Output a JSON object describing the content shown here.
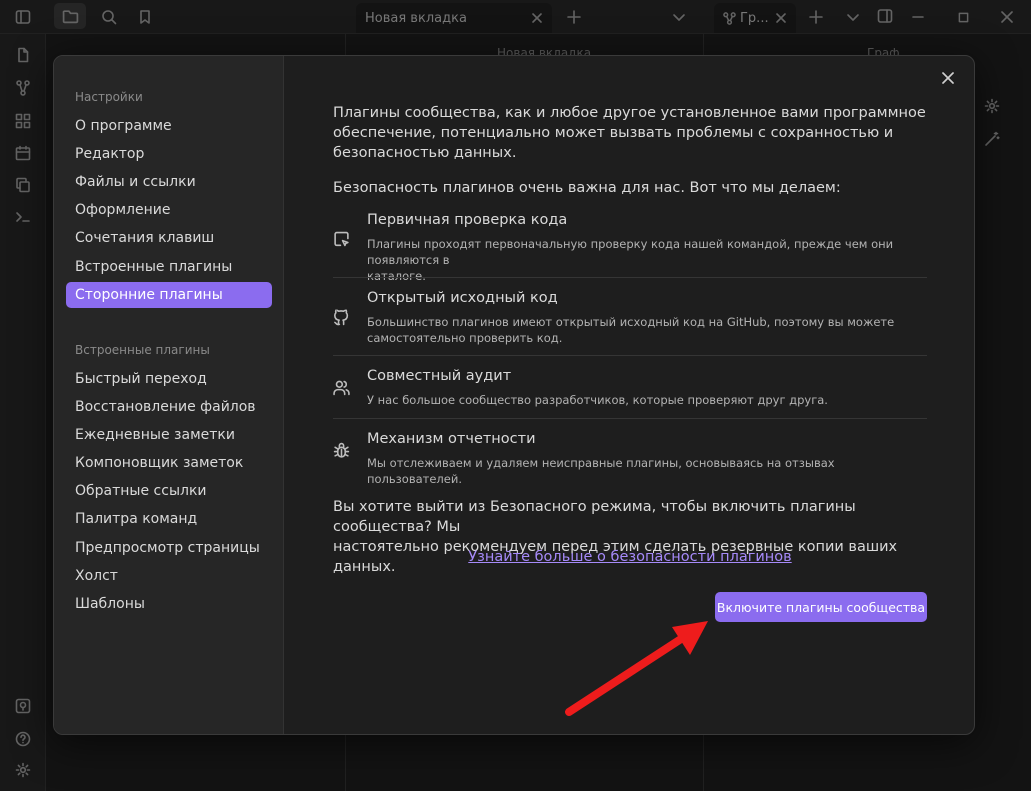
{
  "titlebar": {
    "tabs": [
      {
        "label": "Новая вкладка"
      },
      {
        "label": "Гр..."
      }
    ]
  },
  "panes": {
    "left_title": "",
    "center_title": "Новая вкладка",
    "right_title": "Граф"
  },
  "sidebar": {
    "settings_heading": "Настройки",
    "settings_items": [
      {
        "label": "О программе"
      },
      {
        "label": "Редактор"
      },
      {
        "label": "Файлы и ссылки"
      },
      {
        "label": "Оформление"
      },
      {
        "label": "Сочетания клавиш"
      },
      {
        "label": "Встроенные плагины"
      },
      {
        "label": "Сторонние плагины"
      }
    ],
    "plugins_heading": "Встроенные плагины",
    "plugin_items": [
      {
        "label": "Быстрый переход"
      },
      {
        "label": "Восстановление файлов"
      },
      {
        "label": "Ежедневные заметки"
      },
      {
        "label": "Компоновщик заметок"
      },
      {
        "label": "Обратные ссылки"
      },
      {
        "label": "Палитра команд"
      },
      {
        "label": "Предпросмотр страницы"
      },
      {
        "label": "Холст"
      },
      {
        "label": "Шаблоны"
      }
    ]
  },
  "content": {
    "intro_lines": [
      "Плагины сообщества, как и любое другое установленное вами программное",
      "обеспечение, потенциально может вызвать проблемы с сохранностью и",
      "безопасностью данных."
    ],
    "security_line": "Безопасность плагинов очень важна для нас. Вот что мы делаем:",
    "features": [
      {
        "icon": "code-review-icon",
        "title": "Первичная проверка кода",
        "desc_lines": [
          "Плагины проходят первоначальную проверку кода нашей командой, прежде чем они появляются в",
          "каталоге."
        ]
      },
      {
        "icon": "github-icon",
        "title": "Открытый исходный код",
        "desc_lines": [
          "Большинство плагинов имеют открытый исходный код на GitHub, поэтому вы можете",
          "самостоятельно проверить код."
        ]
      },
      {
        "icon": "users-icon",
        "title": "Совместный аудит",
        "desc_lines": [
          "У нас большое сообщество разработчиков, которые проверяют друг друга."
        ]
      },
      {
        "icon": "bug-icon",
        "title": "Механизм отчетности",
        "desc_lines": [
          "Мы отслеживаем и удаляем неисправные плагины, основываясь на отзывах пользователей."
        ]
      }
    ],
    "question_lines": [
      "Вы хотите выйти из Безопасного режима, чтобы включить плагины сообщества? Мы",
      "настоятельно рекомендуем перед этим сделать резервные копии ваших данных."
    ],
    "learn_more": "Узнайте больше о безопасности плагинов",
    "enable_button": "Включите плагины сообщества"
  },
  "colors": {
    "accent": "#8b6cef",
    "link": "#a68af9",
    "annotation_arrow": "#ee1c1c"
  }
}
